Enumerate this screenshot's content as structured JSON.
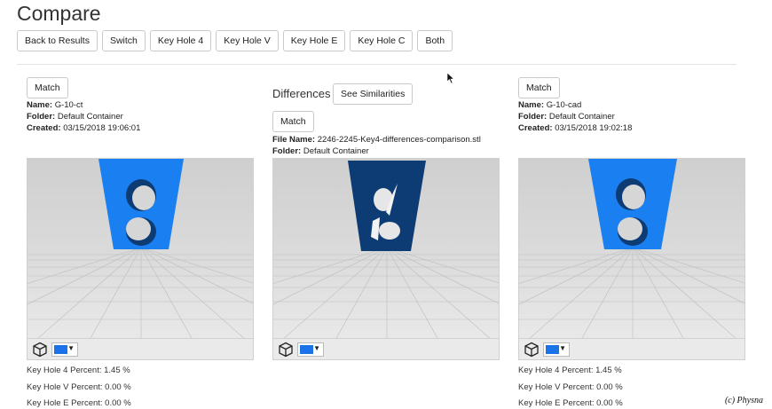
{
  "title": "Compare",
  "toolbar": {
    "buttons": [
      "Back to Results",
      "Switch",
      "Key Hole 4",
      "Key Hole V",
      "Key Hole E",
      "Key Hole C",
      "Both"
    ]
  },
  "left": {
    "match_label": "Match",
    "name_label": "Name:",
    "name_value": "G-10-ct",
    "folder_label": "Folder:",
    "folder_value": "Default Container",
    "created_label": "Created:",
    "created_value": "03/15/2018 19:06:01",
    "color": "#1a73e8",
    "stats": [
      "Key Hole 4 Percent: 1.45 %",
      "Key Hole V Percent: 0.00 %",
      "Key Hole E Percent: 0.00 %"
    ]
  },
  "middle": {
    "heading": "Differences",
    "see_similarities_label": "See Similarities",
    "match_label": "Match",
    "file_label": "File Name:",
    "file_value": "2246-2245-Key4-differences-comparison.stl",
    "folder_label": "Folder:",
    "folder_value": "Default Container",
    "color": "#1a73e8"
  },
  "right": {
    "match_label": "Match",
    "name_label": "Name:",
    "name_value": "G-10-cad",
    "folder_label": "Folder:",
    "folder_value": "Default Container",
    "created_label": "Created:",
    "created_value": "03/15/2018 19:02:18",
    "color": "#1a73e8",
    "stats": [
      "Key Hole 4 Percent: 1.45 %",
      "Key Hole V Percent: 0.00 %",
      "Key Hole E Percent: 0.00 %"
    ]
  },
  "colors": {
    "part_blue": "#1a7ff0",
    "part_dark": "#0d3b73"
  },
  "copyright": "(c) Physna"
}
